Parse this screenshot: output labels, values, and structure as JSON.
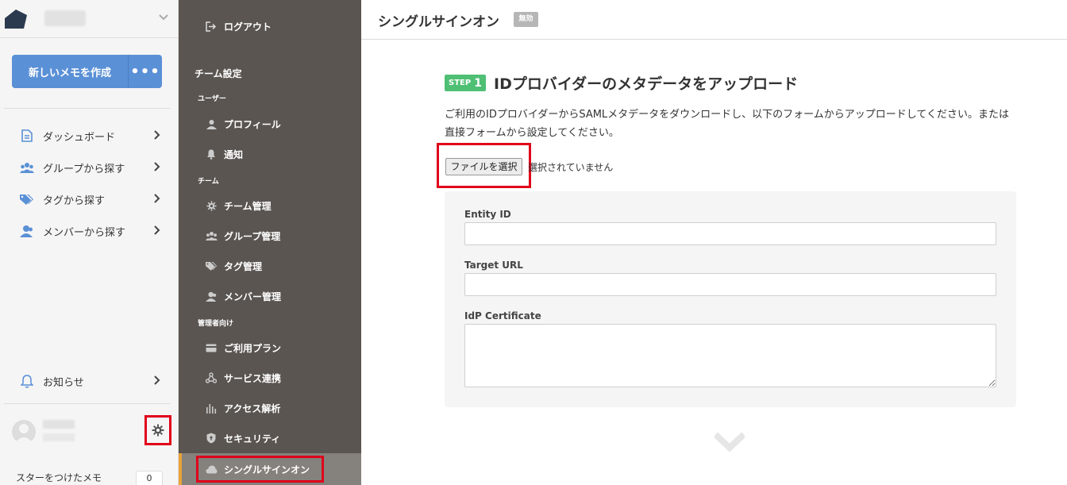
{
  "left_sidebar": {
    "new_memo_label": "新しいメモを作成",
    "more_label": "•••",
    "nav": [
      {
        "label": "ダッシュボード",
        "icon": "document-icon"
      },
      {
        "label": "グループから探す",
        "icon": "group-icon"
      },
      {
        "label": "タグから探す",
        "icon": "tag-icon"
      },
      {
        "label": "メンバーから探す",
        "icon": "member-icon"
      }
    ],
    "notifications_label": "お知らせ",
    "starred_label": "スターをつけたメモ",
    "starred_count": "0"
  },
  "settings_menu": {
    "logout_label": "ログアウト",
    "team_settings_heading": "チーム設定",
    "user_heading": "ユーザー",
    "profile_label": "プロフィール",
    "notify_label": "通知",
    "team_heading": "チーム",
    "team_manage_label": "チーム管理",
    "group_manage_label": "グループ管理",
    "tag_manage_label": "タグ管理",
    "member_manage_label": "メンバー管理",
    "admin_heading": "管理者向け",
    "plan_label": "ご利用プラン",
    "integration_label": "サービス連携",
    "analytics_label": "アクセス解析",
    "security_label": "セキュリティ",
    "sso_label": "シングルサインオン"
  },
  "main": {
    "title": "シングルサインオン",
    "status": "無効",
    "step_label": "STEP",
    "step_number": "1",
    "step_title": "IDプロバイダーのメタデータをアップロード",
    "description": "ご利用のIDプロバイダーからSAMLメタデータをダウンロードし、以下のフォームからアップロードしてください。または直接フォームから設定してください。",
    "file_button": "ファイルを選択",
    "file_status": "選択されていません",
    "form": {
      "entity_id_label": "Entity ID",
      "entity_id_value": "",
      "target_url_label": "Target URL",
      "target_url_value": "",
      "idp_cert_label": "IdP Certificate",
      "idp_cert_value": ""
    }
  },
  "colors": {
    "primary_button": "#5a90d6",
    "settings_bg": "#5a5551",
    "active_accent": "#e8a33a",
    "step_badge": "#4fbf74",
    "highlight_box": "#e0001a"
  }
}
